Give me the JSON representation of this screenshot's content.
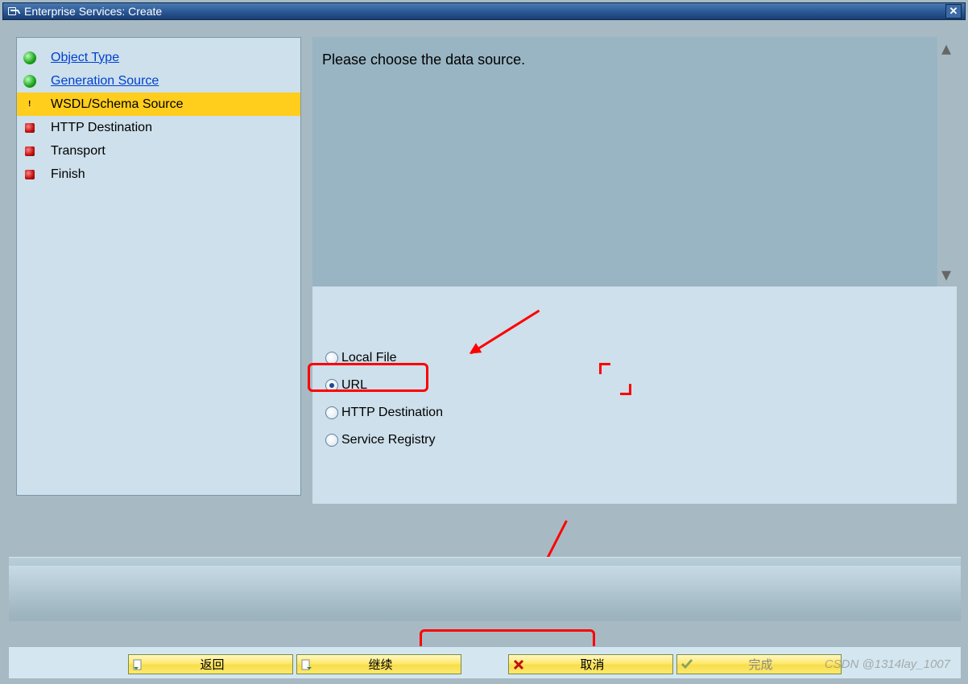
{
  "window": {
    "title": "Enterprise Services: Create"
  },
  "steps": [
    {
      "label": "Object Type",
      "status": "green",
      "link": true
    },
    {
      "label": "Generation Source",
      "status": "green",
      "link": true
    },
    {
      "label": "WSDL/Schema Source",
      "status": "yellow",
      "link": false,
      "active": true
    },
    {
      "label": "HTTP Destination",
      "status": "red",
      "link": false
    },
    {
      "label": "Transport",
      "status": "red",
      "link": false
    },
    {
      "label": "Finish",
      "status": "red",
      "link": false
    }
  ],
  "instruction": "Please choose the data source.",
  "radios": [
    {
      "label": "Local File",
      "selected": false
    },
    {
      "label": "URL",
      "selected": true
    },
    {
      "label": "HTTP Destination",
      "selected": false
    },
    {
      "label": "Service Registry",
      "selected": false
    }
  ],
  "buttons": {
    "back": "返回",
    "continue": "继续",
    "cancel": "取消",
    "finish": "完成"
  },
  "watermark": "CSDN @1314lay_1007"
}
